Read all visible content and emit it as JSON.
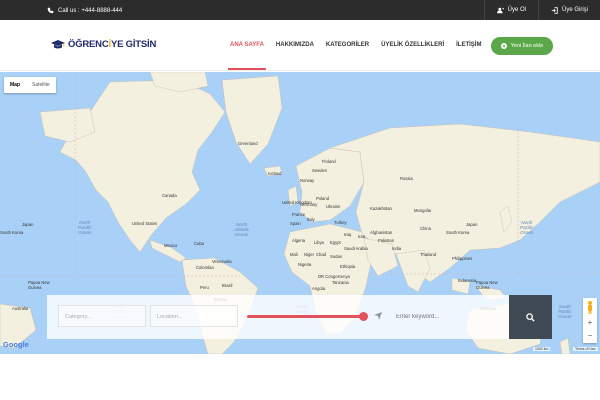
{
  "topbar": {
    "call_text": "Call us : +444-8888-444",
    "register_label": "Üye Ol",
    "login_label": "Üye Girişi"
  },
  "logo": {
    "part1": "ÖĞRENC",
    "part2": "İ",
    "part3": "YE GİTSİN"
  },
  "nav": {
    "items": [
      {
        "label": "ANA SAYFA",
        "active": true
      },
      {
        "label": "HAKKIMIZDA"
      },
      {
        "label": "KATEGORİLER"
      },
      {
        "label": "ÜYELİK ÖZELLİKLERİ"
      },
      {
        "label": "İLETİŞİM"
      }
    ]
  },
  "add_button": {
    "label": "Yeni İlan ekle",
    "icon": "plus-circle-icon"
  },
  "map": {
    "type_controls": [
      "Map",
      "Satellite"
    ],
    "active_type": "Map",
    "oceans": {
      "north_pacific_left": "North\nPacific\nOcean",
      "north_atlantic": "North\nAtlantic\nOcean",
      "north_pacific_right": "North\nPacific\nOcean",
      "south_pacific_left": "South\nPacific\nOcean",
      "south_pacific_mid": "South\nPacific\nOcean",
      "south_pacific_right": "South\nPacific\nOcean"
    },
    "places": {
      "greenland": "Greenland",
      "iceland": "Iceland",
      "canada": "Canada",
      "united_states": "United States",
      "mexico": "Mexico",
      "cuba": "Cuba",
      "venezuela": "Venezuela",
      "colombia": "Colombia",
      "peru": "Peru",
      "brazil": "Brazil",
      "bolivia": "Bolivia",
      "norway": "Norway",
      "sweden": "Sweden",
      "finland": "Finland",
      "uk": "United Kingdom",
      "germany": "Germany",
      "poland": "Poland",
      "ukraine": "Ukraine",
      "france": "France",
      "spain": "Spain",
      "italy": "Italy",
      "turkey": "Turkey",
      "russia": "Russia",
      "kazakhstan": "Kazakhstan",
      "mongolia": "Mongolia",
      "china": "China",
      "japan_left": "Japan",
      "japan_right": "Japan",
      "south_korea_left": "South Korea",
      "south_korea_right": "South Korea",
      "afghanistan": "Afghanistan",
      "iran": "Iran",
      "iraq": "Iraq",
      "pakistan": "Pakistan",
      "india": "India",
      "thailand": "Thailand",
      "algeria": "Algeria",
      "libya": "Libya",
      "egypt": "Egypt",
      "saudi_arabia": "Saudi Arabia",
      "mali": "Mali",
      "niger": "Niger",
      "chad": "Chad",
      "sudan": "Sudan",
      "nigeria": "Nigeria",
      "ethiopia": "Ethiopia",
      "dr_congo": "DR Congo",
      "kenya": "Kenya",
      "tanzania": "Tanzania",
      "angola": "Angola",
      "indonesia": "Indonesia",
      "png_right": "Papua New\nGuinea",
      "png_left": "Papua New\nGuinea",
      "australia_left": "Australia",
      "australia_right": "Australia",
      "philippines": "Philippines"
    },
    "google_label": "Google",
    "scale_label": "1000 km",
    "terms_label": "Terms of Use"
  },
  "search": {
    "category_placeholder": "Category...",
    "location_placeholder": "Location...",
    "keyword_placeholder": "Enter keyword...",
    "radius_percent": 95
  },
  "colors": {
    "accent": "#e2525a",
    "green": "#5aa84a",
    "dark": "#2c2c2c",
    "water": "#a9d1f7",
    "land": "#f4f0e0"
  }
}
